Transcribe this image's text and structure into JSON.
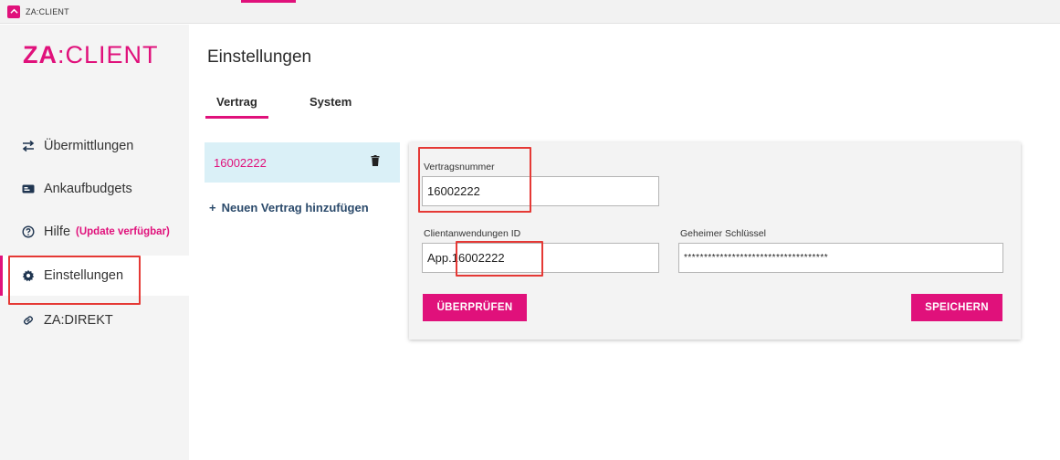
{
  "window": {
    "title": "ZA:CLIENT",
    "accent": "#e0117b"
  },
  "logo": {
    "za": "ZA",
    "client": ":CLIENT"
  },
  "sidebar": {
    "items": [
      {
        "label": "Übermittlungen",
        "icon": "arrows-exchange-icon"
      },
      {
        "label": "Ankaufbudgets",
        "icon": "card-icon"
      },
      {
        "label": "Hilfe",
        "badge": "(Update verfügbar)",
        "icon": "help-circle-icon"
      },
      {
        "label": "Einstellungen",
        "icon": "gear-icon",
        "active": true
      },
      {
        "label": "ZA:DIREKT",
        "icon": "link-icon"
      }
    ]
  },
  "main": {
    "title": "Einstellungen",
    "tabs": [
      {
        "label": "Vertrag",
        "active": true
      },
      {
        "label": "System",
        "active": false
      }
    ],
    "contracts": [
      {
        "number": "16002222"
      }
    ],
    "add_contract_label": "Neuen Vertrag hinzufügen",
    "form": {
      "contract_number_label": "Vertragsnummer",
      "contract_number_value": "16002222",
      "client_app_id_label": "Clientanwendungen ID",
      "client_app_id_value": "App.16002222",
      "secret_key_label": "Geheimer Schlüssel",
      "secret_key_value": "************************************",
      "check_button": "ÜBERPRÜFEN",
      "save_button": "SPEICHERN"
    }
  }
}
